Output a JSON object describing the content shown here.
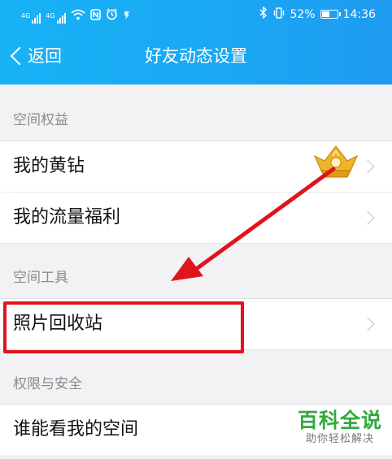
{
  "status_bar": {
    "signal_1_label": "4G",
    "signal_2_label": "4G",
    "battery_text": "52%",
    "battery_level": 0.52,
    "time": "14:36",
    "icons": [
      "wifi-icon",
      "nfc-icon",
      "alarm-icon",
      "bluetooth-icon",
      "vibrate-icon",
      "battery-icon"
    ]
  },
  "nav": {
    "back_label": "返回",
    "title": "好友动态设置"
  },
  "sections": [
    {
      "header": "空间权益",
      "items": [
        {
          "label": "我的黄钻"
        },
        {
          "label": "我的流量福利"
        }
      ]
    },
    {
      "header": "空间工具",
      "items": [
        {
          "label": "照片回收站"
        }
      ]
    },
    {
      "header": "权限与安全",
      "items": [
        {
          "label": "谁能看我的空间"
        }
      ]
    }
  ],
  "watermark": {
    "main": "百科全说",
    "sub": "助你轻松解决"
  },
  "colors": {
    "header_blue": "#1aa8f3",
    "annotation_red": "#e0141c",
    "watermark_green": "#2eaa3c",
    "crown_gold": "#e8a21a"
  }
}
